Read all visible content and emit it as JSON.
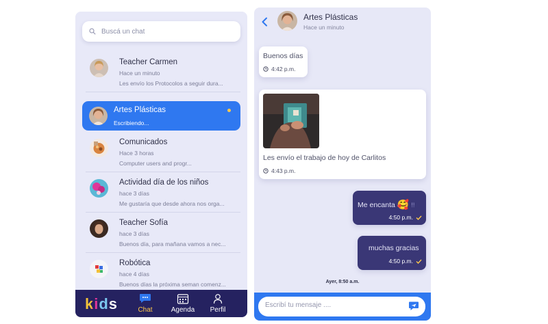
{
  "left": {
    "search_placeholder": "Buscá un chat",
    "chats": [
      {
        "name": "Teacher Carmen",
        "time": "Hace un minuto",
        "preview": "Les envío los Protocolos a seguir dura..."
      },
      {
        "name": "Artes Plásticas",
        "preview": "Escribiendo...",
        "active": true
      },
      {
        "name": "Comunicados",
        "time": "Hace 3 horas",
        "preview": "Computer users and progr..."
      },
      {
        "name": "Actividad día de los niños",
        "time": "hace 3 días",
        "preview": "Me gustaría que desde ahora nos orga..."
      },
      {
        "name": "Teacher Sofía",
        "time": "hace 3 días",
        "preview": "Buenos día, para mañana vamos a nec..."
      },
      {
        "name": "Robótica",
        "time": "hace 4 días",
        "preview": "Buenos días la próxima seman comenz..."
      }
    ],
    "nav": {
      "logo": "kids",
      "chat": "Chat",
      "agenda": "Agenda",
      "perfil": "Perfil"
    }
  },
  "right": {
    "header": {
      "title": "Artes Plásticas",
      "subtitle": "Hace un minuto"
    },
    "messages": [
      {
        "text": "Buenos días",
        "time": "4:42 p.m."
      },
      {
        "text": "Les envío el trabajo de hoy de Carlitos",
        "time": "4:43 p.m."
      },
      {
        "text": "Me encanta",
        "emoji": "🥰",
        "marks": "!!",
        "time": "4:50 p.m."
      },
      {
        "text": "muchas gracias",
        "time": "4:50 p.m."
      }
    ],
    "date_label": "Ayer, 8:50 a.m.",
    "compose_placeholder": "Escribí tu mensaje ...."
  },
  "colors": {
    "accent_blue": "#2f78f0",
    "navy": "#252260",
    "outgoing_bubble": "#3a3776",
    "panel_bg": "#e8e9f8",
    "highlight_yellow": "#ffc94a"
  }
}
